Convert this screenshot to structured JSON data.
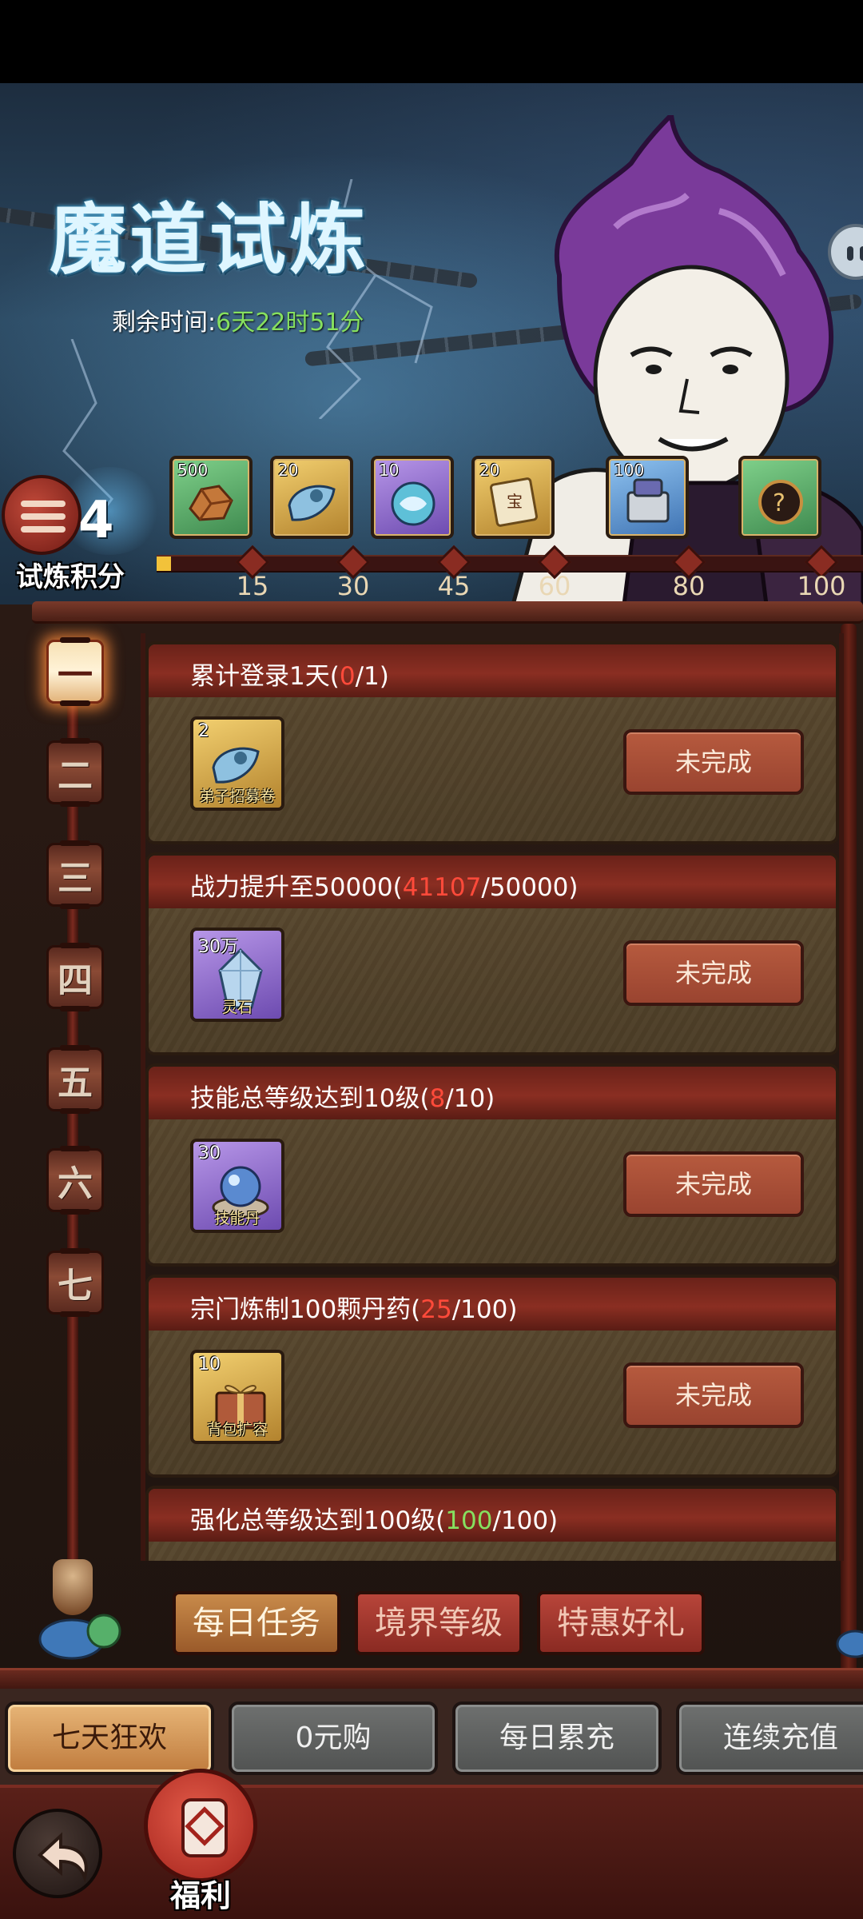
{
  "event": {
    "title": "魔道试炼",
    "time_label": "剩余时间:",
    "time_value": "6天22时51分"
  },
  "score": {
    "value": "4",
    "label": "试炼积分",
    "progress_fraction": 0.02
  },
  "milestones": [
    {
      "threshold": "15",
      "reward_count": "500",
      "reward_icon": "ore-icon",
      "color": "green"
    },
    {
      "threshold": "30",
      "reward_count": "20",
      "reward_icon": "recruit-scroll-icon",
      "color": "gold"
    },
    {
      "threshold": "45",
      "reward_count": "10",
      "reward_icon": "dragon-orb-icon",
      "color": "purple"
    },
    {
      "threshold": "60",
      "reward_count": "20",
      "reward_icon": "treasure-scroll-icon",
      "color": "gold"
    },
    {
      "threshold": "80",
      "reward_count": "100",
      "reward_icon": "treasure-box-icon",
      "color": "blue"
    },
    {
      "threshold": "100",
      "reward_count": "",
      "reward_icon": "mystery-box-icon",
      "color": "green"
    }
  ],
  "days": [
    "一",
    "二",
    "三",
    "四",
    "五",
    "六",
    "七"
  ],
  "active_day": 0,
  "tasks": [
    {
      "title_prefix": "累计登录1天(",
      "current": "0",
      "title_suffix": "/1)",
      "done": false,
      "item_qty": "2",
      "item_name": "弟子招募卷",
      "item_color": "gold",
      "item_icon": "recruit-scroll-icon",
      "status": "未完成"
    },
    {
      "title_prefix": "战力提升至50000(",
      "current": "41107",
      "title_suffix": "/50000)",
      "done": false,
      "item_qty": "30万",
      "item_name": "灵石",
      "item_color": "purple",
      "item_icon": "spirit-stone-icon",
      "status": "未完成"
    },
    {
      "title_prefix": "技能总等级达到10级(",
      "current": "8",
      "title_suffix": "/10)",
      "done": false,
      "item_qty": "30",
      "item_name": "技能丹",
      "item_color": "purple",
      "item_icon": "skill-pill-icon",
      "status": "未完成"
    },
    {
      "title_prefix": "宗门炼制100颗丹药(",
      "current": "25",
      "title_suffix": "/100)",
      "done": false,
      "item_qty": "10",
      "item_name": "背包扩容",
      "item_color": "gold",
      "item_icon": "gift-box-icon",
      "status": "未完成"
    },
    {
      "title_prefix": "强化总等级达到100级(",
      "current": "100",
      "title_suffix": "/100)",
      "done": true,
      "item_qty": "",
      "item_name": "",
      "item_color": "green",
      "item_icon": "",
      "status": ""
    }
  ],
  "category_tabs": [
    "每日任务",
    "境界等级",
    "特惠好礼"
  ],
  "active_category": 0,
  "bottom_tabs": [
    "七天狂欢",
    "0元购",
    "每日累充",
    "连续充值"
  ],
  "active_bottom_tab": 0,
  "nav": {
    "welfare_label": "福利"
  },
  "colors": {
    "progress_current": "#ff4a3a",
    "progress_done": "#86e05f",
    "time_value": "#86e05f"
  }
}
